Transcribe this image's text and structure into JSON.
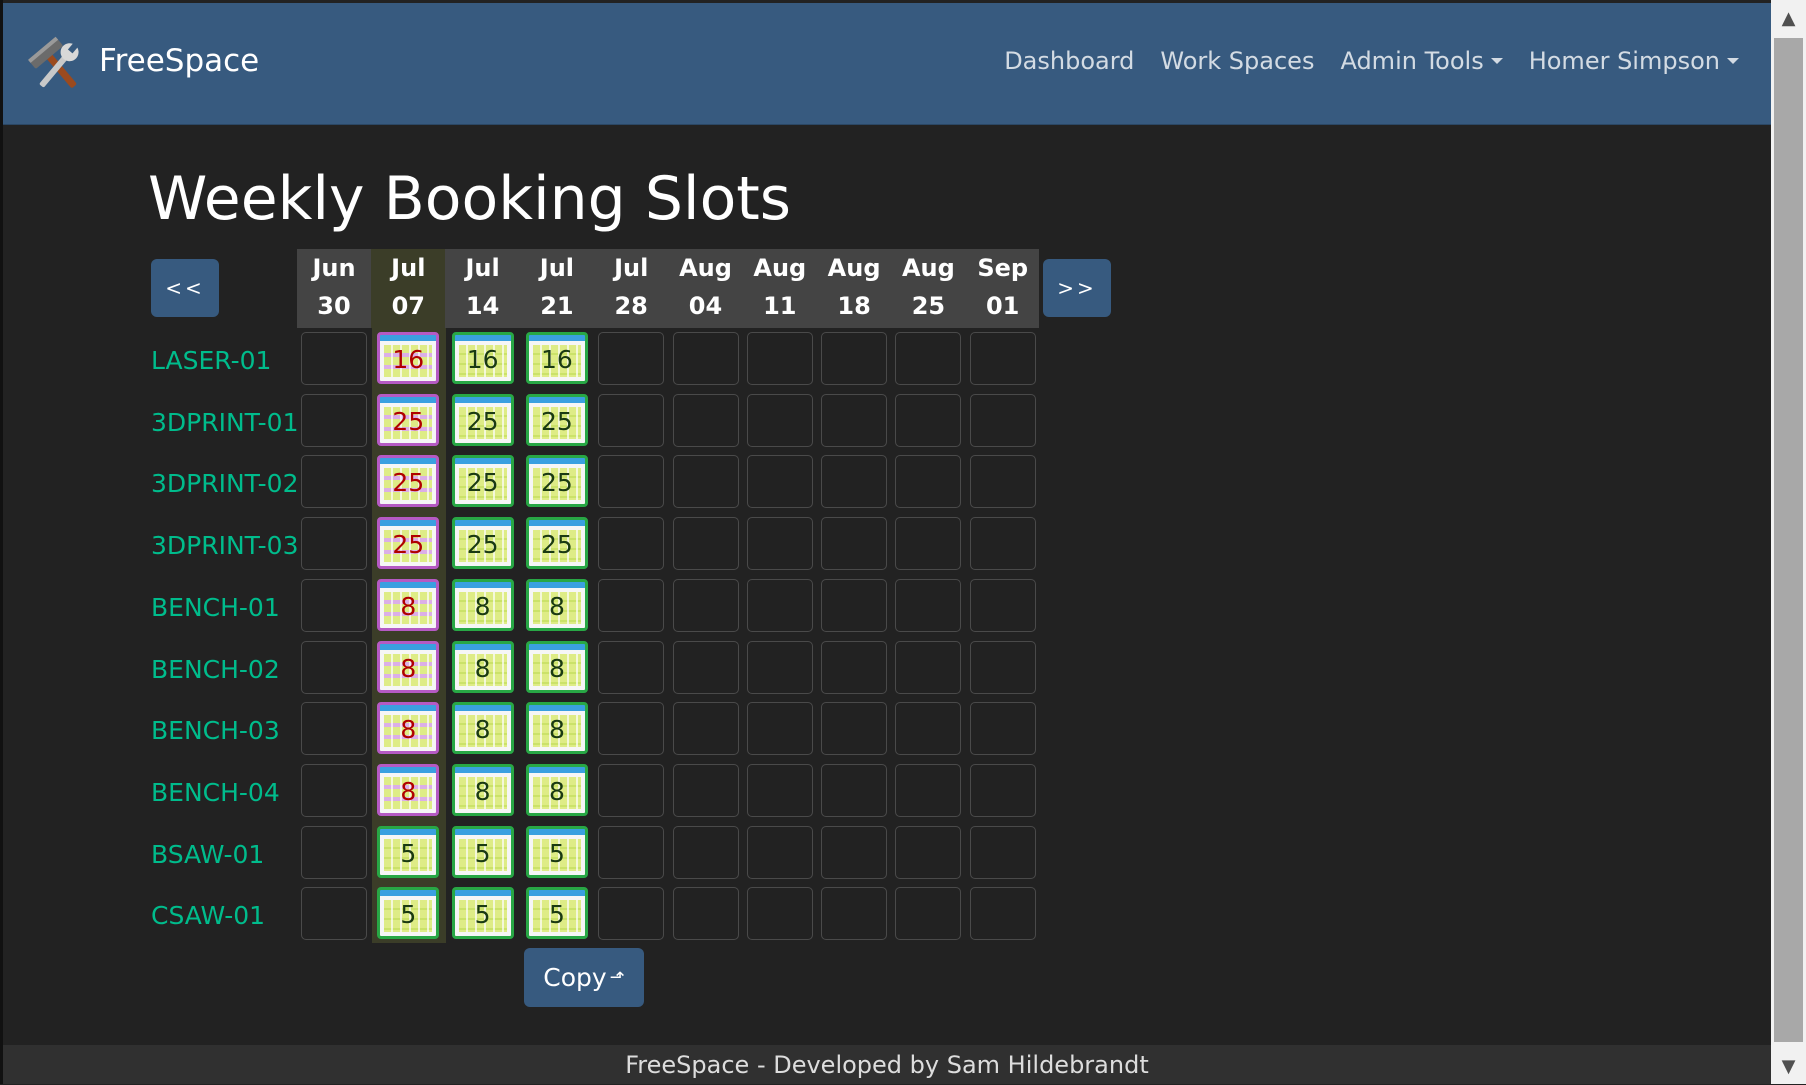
{
  "navbar": {
    "brand": "FreeSpace",
    "brand_icon": "tools-icon",
    "links": [
      {
        "label": "Dashboard",
        "dropdown": false
      },
      {
        "label": "Work Spaces",
        "dropdown": false
      },
      {
        "label": "Admin Tools",
        "dropdown": true
      },
      {
        "label": "Homer Simpson",
        "dropdown": true
      }
    ]
  },
  "page": {
    "title": "Weekly Booking Slots",
    "prev_label": "<<",
    "next_label": ">>",
    "copy_label": "Copy",
    "copy_icon": "copy-arrow-icon"
  },
  "weeks": [
    {
      "month": "Jun",
      "day": "30"
    },
    {
      "month": "Jul",
      "day": "07",
      "current": true
    },
    {
      "month": "Jul",
      "day": "14"
    },
    {
      "month": "Jul",
      "day": "21"
    },
    {
      "month": "Jul",
      "day": "28"
    },
    {
      "month": "Aug",
      "day": "04"
    },
    {
      "month": "Aug",
      "day": "11"
    },
    {
      "month": "Aug",
      "day": "18"
    },
    {
      "month": "Aug",
      "day": "25"
    },
    {
      "month": "Sep",
      "day": "01"
    }
  ],
  "rows": [
    {
      "space": "LASER-01",
      "slots": [
        null,
        {
          "count": "16",
          "status": "pending"
        },
        {
          "count": "16",
          "status": "confirmed"
        },
        {
          "count": "16",
          "status": "confirmed"
        },
        null,
        null,
        null,
        null,
        null,
        null
      ]
    },
    {
      "space": "3DPRINT-01",
      "slots": [
        null,
        {
          "count": "25",
          "status": "pending"
        },
        {
          "count": "25",
          "status": "confirmed"
        },
        {
          "count": "25",
          "status": "confirmed"
        },
        null,
        null,
        null,
        null,
        null,
        null
      ]
    },
    {
      "space": "3DPRINT-02",
      "slots": [
        null,
        {
          "count": "25",
          "status": "pending"
        },
        {
          "count": "25",
          "status": "confirmed"
        },
        {
          "count": "25",
          "status": "confirmed"
        },
        null,
        null,
        null,
        null,
        null,
        null
      ]
    },
    {
      "space": "3DPRINT-03",
      "slots": [
        null,
        {
          "count": "25",
          "status": "pending"
        },
        {
          "count": "25",
          "status": "confirmed"
        },
        {
          "count": "25",
          "status": "confirmed"
        },
        null,
        null,
        null,
        null,
        null,
        null
      ]
    },
    {
      "space": "BENCH-01",
      "slots": [
        null,
        {
          "count": "8",
          "status": "pending"
        },
        {
          "count": "8",
          "status": "confirmed"
        },
        {
          "count": "8",
          "status": "confirmed"
        },
        null,
        null,
        null,
        null,
        null,
        null
      ]
    },
    {
      "space": "BENCH-02",
      "slots": [
        null,
        {
          "count": "8",
          "status": "pending"
        },
        {
          "count": "8",
          "status": "confirmed"
        },
        {
          "count": "8",
          "status": "confirmed"
        },
        null,
        null,
        null,
        null,
        null,
        null
      ]
    },
    {
      "space": "BENCH-03",
      "slots": [
        null,
        {
          "count": "8",
          "status": "pending"
        },
        {
          "count": "8",
          "status": "confirmed"
        },
        {
          "count": "8",
          "status": "confirmed"
        },
        null,
        null,
        null,
        null,
        null,
        null
      ]
    },
    {
      "space": "BENCH-04",
      "slots": [
        null,
        {
          "count": "8",
          "status": "pending"
        },
        {
          "count": "8",
          "status": "confirmed"
        },
        {
          "count": "8",
          "status": "confirmed"
        },
        null,
        null,
        null,
        null,
        null,
        null
      ]
    },
    {
      "space": "BSAW-01",
      "slots": [
        null,
        {
          "count": "5",
          "status": "confirmed"
        },
        {
          "count": "5",
          "status": "confirmed"
        },
        {
          "count": "5",
          "status": "confirmed"
        },
        null,
        null,
        null,
        null,
        null,
        null
      ]
    },
    {
      "space": "CSAW-01",
      "slots": [
        null,
        {
          "count": "5",
          "status": "confirmed"
        },
        {
          "count": "5",
          "status": "confirmed"
        },
        {
          "count": "5",
          "status": "confirmed"
        },
        null,
        null,
        null,
        null,
        null,
        null
      ]
    }
  ],
  "footer": {
    "text": "FreeSpace - Developed by Sam Hildebrandt"
  },
  "colors": {
    "navbar": "#375a7f",
    "background": "#222222",
    "link": "#00bc8c",
    "confirmed": "#28a745",
    "pending": "#b55ac3"
  }
}
